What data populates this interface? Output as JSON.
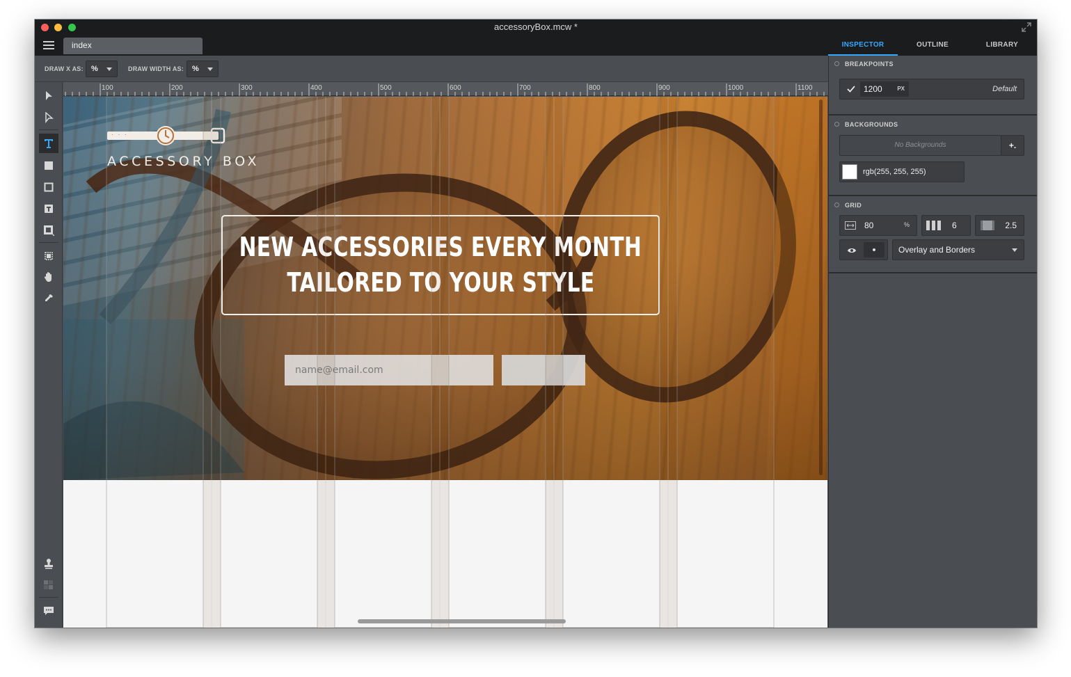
{
  "window": {
    "title": "accessoryBox.mcw *"
  },
  "tabs": {
    "document_tab": "index"
  },
  "panel_tabs": [
    {
      "label": "INSPECTOR",
      "active": true
    },
    {
      "label": "OUTLINE",
      "active": false
    },
    {
      "label": "LIBRARY",
      "active": false
    }
  ],
  "options_bar": {
    "draw_x_label": "DRAW X AS:",
    "draw_x_value": "%",
    "draw_width_label": "DRAW WIDTH AS:",
    "draw_width_value": "%"
  },
  "tools": [
    {
      "name": "select-arrow-icon",
      "active": false
    },
    {
      "name": "direct-select-icon",
      "active": false
    },
    {
      "name": "text-tool-icon",
      "active": true
    },
    {
      "name": "rectangle-fill-icon",
      "active": false
    },
    {
      "name": "rectangle-outline-icon",
      "active": false
    },
    {
      "name": "text-box-icon",
      "active": false
    },
    {
      "name": "image-box-icon",
      "active": false
    },
    {
      "name": "crop-icon",
      "active": false
    },
    {
      "name": "hand-icon",
      "active": false
    },
    {
      "name": "eyedropper-icon",
      "active": false
    },
    {
      "name": "stamp-icon",
      "active": false
    },
    {
      "name": "pattern-icon",
      "active": false
    },
    {
      "name": "comment-icon",
      "active": false
    }
  ],
  "ruler": {
    "labels": [
      "100",
      "200",
      "300",
      "400",
      "500",
      "600",
      "700",
      "800",
      "900",
      "1000",
      "1100"
    ]
  },
  "canvas": {
    "logo_text": "ACCESSORY BOX",
    "logo_dots": "· · ·",
    "headline_line1": "NEW ACCESSORIES EVERY MONTH",
    "headline_line2": "TAILORED TO YOUR STYLE",
    "email_placeholder": "name@email.com",
    "submit_label": ""
  },
  "inspector": {
    "breakpoints": {
      "title": "BREAKPOINTS",
      "value": "1200",
      "unit": "PX",
      "label": "Default"
    },
    "backgrounds": {
      "title": "BACKGROUNDS",
      "empty_text": "No Backgrounds",
      "add_label": "+.",
      "color_text": "rgb(255, 255, 255)"
    },
    "grid": {
      "title": "GRID",
      "width_value": "80",
      "width_unit": "%",
      "columns_value": "6",
      "gutter_value": "2.5",
      "display_mode": "Overlay and Borders"
    }
  },
  "colors": {
    "accent": "#35a8ff",
    "panel_bg": "#4a4d51",
    "titlebar_bg": "#1b1c1d"
  }
}
